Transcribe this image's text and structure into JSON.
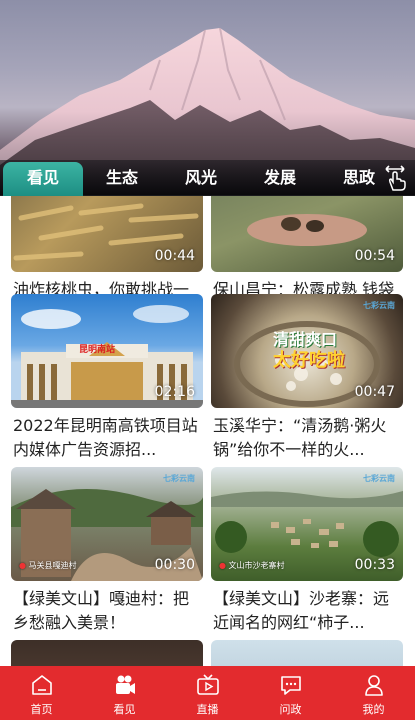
{
  "tabs": [
    {
      "label": "看见",
      "active": true
    },
    {
      "label": "生态",
      "active": false
    },
    {
      "label": "风光",
      "active": false
    },
    {
      "label": "发展",
      "active": false
    },
    {
      "label": "思政",
      "active": false
    }
  ],
  "tab_expand_icon": "expand-hand-icon",
  "feed": [
    {
      "title": "油炸核桃虫，你敢挑战一下吗？",
      "duration": "00:44"
    },
    {
      "title": "保山昌宁：松露成熟 钱袋鼓鼓",
      "duration": "00:54"
    },
    {
      "title": "2022年昆明南高铁项目站内媒体广告资源招...",
      "duration": "02:16",
      "sign_text": "昆明南站"
    },
    {
      "title": "玉溪华宁：“清汤鹅·粥火锅”给你不一样的火...",
      "duration": "00:47",
      "overlay_line1": "清甜爽口",
      "overlay_line2": "太好吃啦",
      "watermark": "七彩云南"
    },
    {
      "title": "【绿美文山】嘎迪村：把乡愁融入美景！",
      "duration": "00:30",
      "location": "马关县嘎迪村",
      "watermark": "七彩云南"
    },
    {
      "title": "【绿美文山】沙老寨：远近闻名的网红“柿子...",
      "duration": "00:33",
      "location": "文山市沙老寨村",
      "watermark": "七彩云南"
    }
  ],
  "bottom_nav": [
    {
      "label": "首页",
      "icon": "home-icon",
      "active": false
    },
    {
      "label": "看见",
      "icon": "video-camera-icon",
      "active": true
    },
    {
      "label": "直播",
      "icon": "tv-live-icon",
      "active": false
    },
    {
      "label": "问政",
      "icon": "chat-question-icon",
      "active": false
    },
    {
      "label": "我的",
      "icon": "user-icon",
      "active": false
    }
  ],
  "colors": {
    "brand_red": "#e32b2e",
    "tab_active": "#1d8e83"
  }
}
